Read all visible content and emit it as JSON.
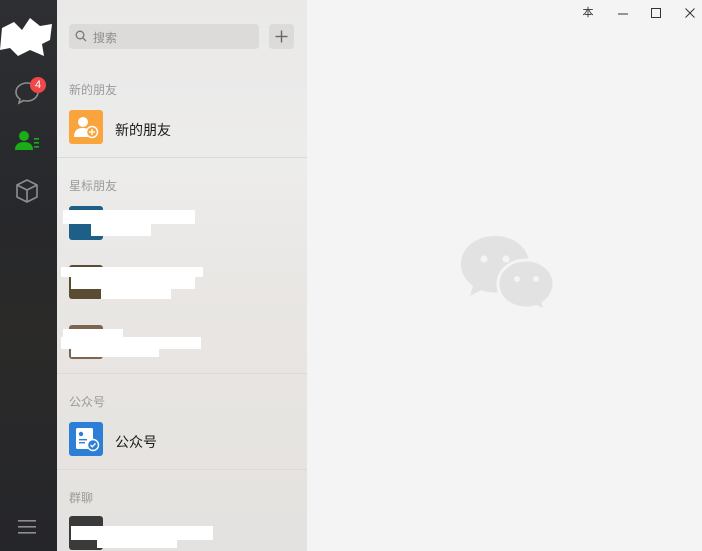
{
  "nav": {
    "chats_badge": "4"
  },
  "search": {
    "placeholder": "搜索"
  },
  "sections": {
    "new_friends_header": "新的朋友",
    "new_friends_item": "新的朋友",
    "starred_header": "星标朋友",
    "official_header": "公众号",
    "official_item": "公众号",
    "groups_header": "群聊"
  },
  "window": {
    "pin_glyph": "本"
  },
  "colors": {
    "accent_green": "#1aad19",
    "badge_red": "#f04848",
    "new_friend_orange": "#f9a43d",
    "official_blue": "#2d7ed6"
  }
}
